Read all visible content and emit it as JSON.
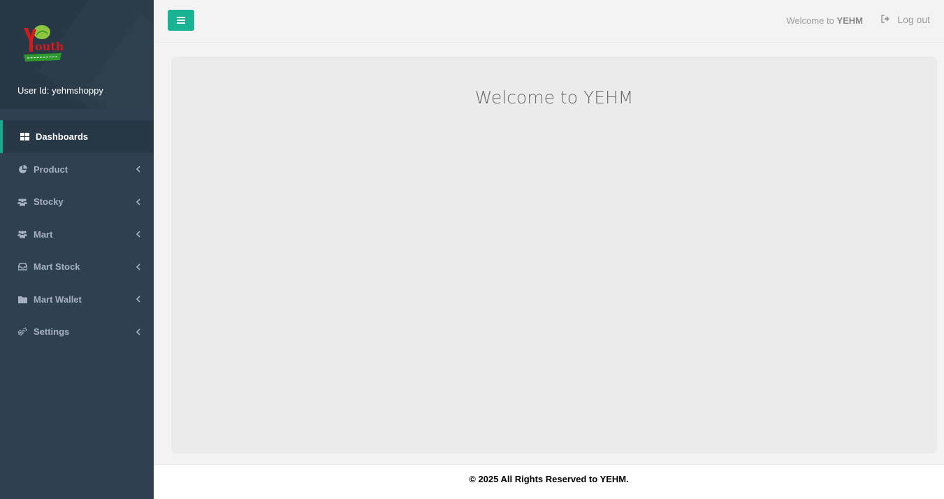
{
  "sidebar": {
    "user_id": "User Id: yehmshoppy",
    "items": [
      {
        "label": "Dashboards",
        "icon": "th-large-icon"
      },
      {
        "label": "Product",
        "icon": "pie-chart-icon"
      },
      {
        "label": "Stocky",
        "icon": "users-icon"
      },
      {
        "label": "Mart",
        "icon": "users-icon"
      },
      {
        "label": "Mart Stock",
        "icon": "inbox-icon"
      },
      {
        "label": "Mart Wallet",
        "icon": "folder-icon"
      },
      {
        "label": "Settings",
        "icon": "cogs-icon"
      }
    ]
  },
  "topbar": {
    "welcome_prefix": "Welcome to",
    "welcome_brand": "YEHM",
    "logout_label": "Log out"
  },
  "main": {
    "title": "Welcome to YEHM"
  },
  "footer": {
    "text": "© 2025 All Rights Reserved to YEHM."
  },
  "colors": {
    "sidebar_bg": "#2f4050",
    "accent": "#1ab394"
  }
}
